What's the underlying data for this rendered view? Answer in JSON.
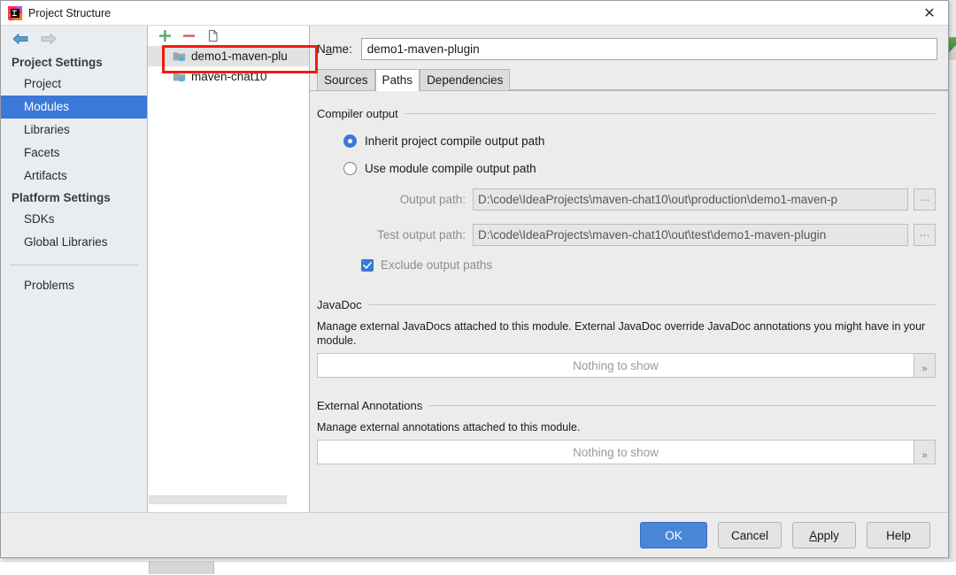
{
  "window": {
    "title": "Project Structure",
    "app_icon": "intellij-idea-icon",
    "close_label": "✕"
  },
  "nav": {
    "back_icon": "back-arrow-icon",
    "forward_icon": "forward-arrow-icon",
    "groups": [
      {
        "title": "Project Settings",
        "items": [
          {
            "label": "Project",
            "selected": false
          },
          {
            "label": "Modules",
            "selected": true
          },
          {
            "label": "Libraries",
            "selected": false
          },
          {
            "label": "Facets",
            "selected": false
          },
          {
            "label": "Artifacts",
            "selected": false
          }
        ]
      },
      {
        "title": "Platform Settings",
        "items": [
          {
            "label": "SDKs",
            "selected": false
          },
          {
            "label": "Global Libraries",
            "selected": false
          }
        ]
      }
    ],
    "problems_label": "Problems"
  },
  "tree": {
    "toolbar": {
      "add_label": "+",
      "remove_label": "−",
      "copy_icon": "copy-module-icon"
    },
    "modules": [
      {
        "label": "demo1-maven-plu",
        "selected": true
      },
      {
        "label": "maven-chat10",
        "selected": false
      }
    ]
  },
  "module": {
    "name_label_pre": "N",
    "name_label_mnemonic": "a",
    "name_label_post": "me:",
    "name_value": "demo1-maven-plugin",
    "name_placeholder": "",
    "tabs": [
      {
        "label": "Sources",
        "active": false
      },
      {
        "label": "Paths",
        "active": true
      },
      {
        "label": "Dependencies",
        "active": false
      }
    ]
  },
  "compiler_output": {
    "group_title": "Compiler output",
    "radio_inherit": "Inherit project compile output path",
    "radio_module": "Use module compile output path",
    "selected": "inherit",
    "output_path_label": "Output path:",
    "output_path_value": "D:\\code\\IdeaProjects\\maven-chat10\\out\\production\\demo1-maven-p",
    "test_output_path_label": "Test output path:",
    "test_output_path_value": "D:\\code\\IdeaProjects\\maven-chat10\\out\\test\\demo1-maven-plugin",
    "browse_label": "⋯",
    "exclude_label": "Exclude output paths",
    "exclude_checked": true
  },
  "javadoc": {
    "group_title": "JavaDoc",
    "description": "Manage external JavaDocs attached to this module. External JavaDoc override JavaDoc annotations you might have in your module.",
    "empty_text": "Nothing to show",
    "expand_label": "»"
  },
  "external_annotations": {
    "group_title": "External Annotations",
    "description": "Manage external annotations attached to this module.",
    "empty_text": "Nothing to show",
    "expand_label": "»"
  },
  "footer": {
    "ok_label": "OK",
    "cancel_label": "Cancel",
    "apply_label_pre": "",
    "apply_label_mnemonic": "A",
    "apply_label_post": "pply",
    "help_label": "Help"
  },
  "colors": {
    "accent": "#3c78d8",
    "default_button": "#4a86d8",
    "selection": "#3c78d8",
    "annotation": "#f41b0c",
    "nav_bg": "#e9edf2",
    "dialog_bg": "#ececec"
  }
}
